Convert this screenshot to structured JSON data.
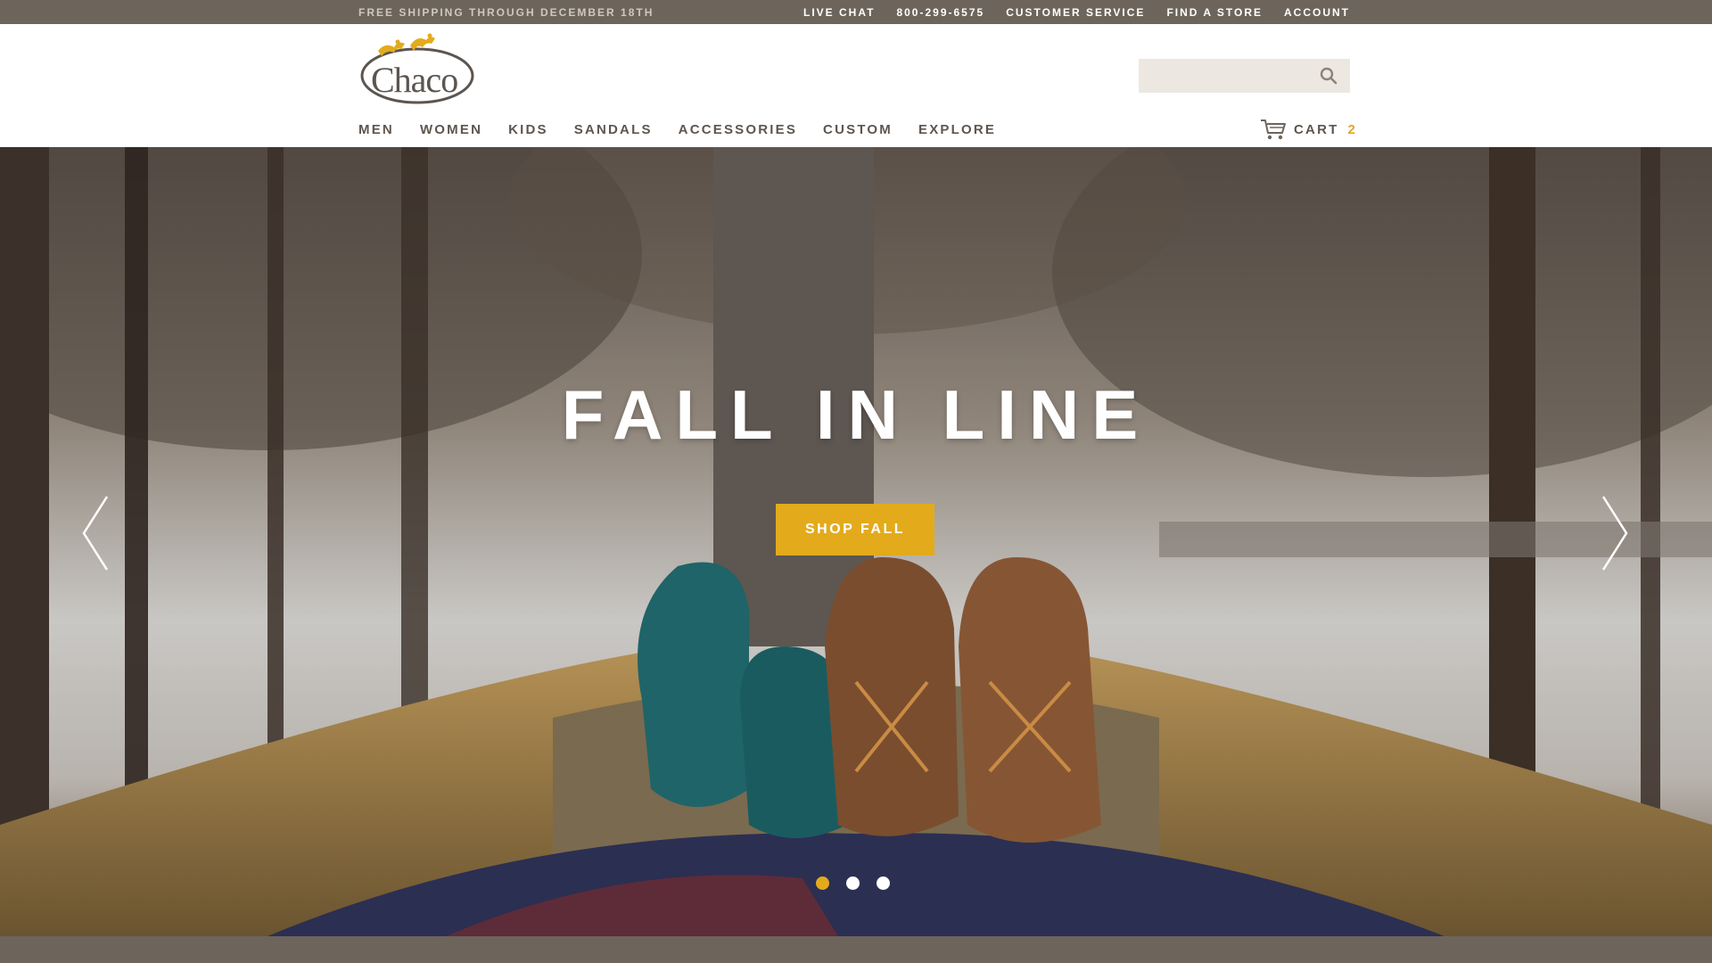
{
  "topbar": {
    "promo": "FREE SHIPPING THROUGH DECEMBER 18TH",
    "links": {
      "live_chat": "LIVE CHAT",
      "phone": "800-299-6575",
      "customer_service": "CUSTOMER SERVICE",
      "find_store": "FIND A STORE",
      "account": "ACCOUNT"
    }
  },
  "header": {
    "logo_text": "Chaco",
    "search": {
      "placeholder": "",
      "value": "",
      "icon": "search-icon"
    },
    "nav": {
      "men": "MEN",
      "women": "WOMEN",
      "kids": "KIDS",
      "sandals": "SANDALS",
      "accessories": "ACCESSORIES",
      "custom": "CUSTOM",
      "explore": "EXPLORE"
    },
    "cart": {
      "label": "CART",
      "count": "2",
      "icon": "cart-icon"
    }
  },
  "hero": {
    "title": "FALL IN LINE",
    "cta": "SHOP FALL",
    "prev_icon": "chevron-left-icon",
    "next_icon": "chevron-right-icon",
    "slides_total": 3,
    "active_slide": 1
  },
  "colors": {
    "topbar_bg": "#6d655c",
    "accent": "#e3ab1c",
    "nav_text": "#5e564e",
    "search_bg": "#ece8e1"
  }
}
